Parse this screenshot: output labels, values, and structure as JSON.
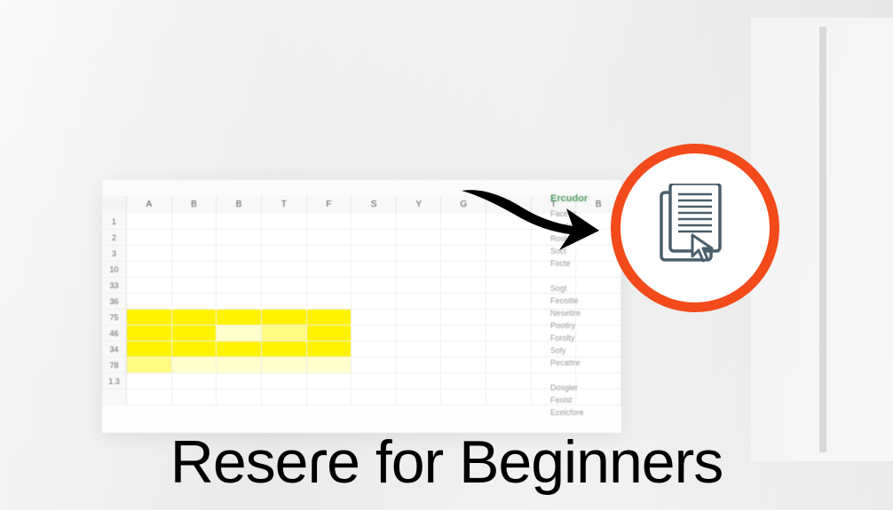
{
  "title": "Reseɾe for Beginners",
  "spreadsheet": {
    "columns": [
      "A",
      "B",
      "B",
      "T",
      "F",
      "S",
      "Y",
      "G",
      "F",
      "T",
      "B"
    ],
    "rows": [
      "1",
      "2",
      "3",
      "10",
      "33",
      "36",
      "75",
      "46",
      "34",
      "78",
      "1.3",
      ""
    ],
    "highlighted_rows": [
      6,
      7,
      8,
      9
    ]
  },
  "side_panel": {
    "title": "Ercudor",
    "items": [
      "Facefic",
      "Sostle",
      "Rost",
      "Soct",
      "Focte",
      "",
      "Sogt",
      "Feositle",
      "Nesettre",
      "Pootlry",
      "Forolty",
      "Soly",
      "Pecattre",
      "",
      "Dosgler",
      "Feolst",
      "Ecelcfore",
      ""
    ]
  },
  "colors": {
    "accent": "#f24a1a",
    "highlight": "#fff200",
    "panel_title": "#4a9d5f"
  }
}
